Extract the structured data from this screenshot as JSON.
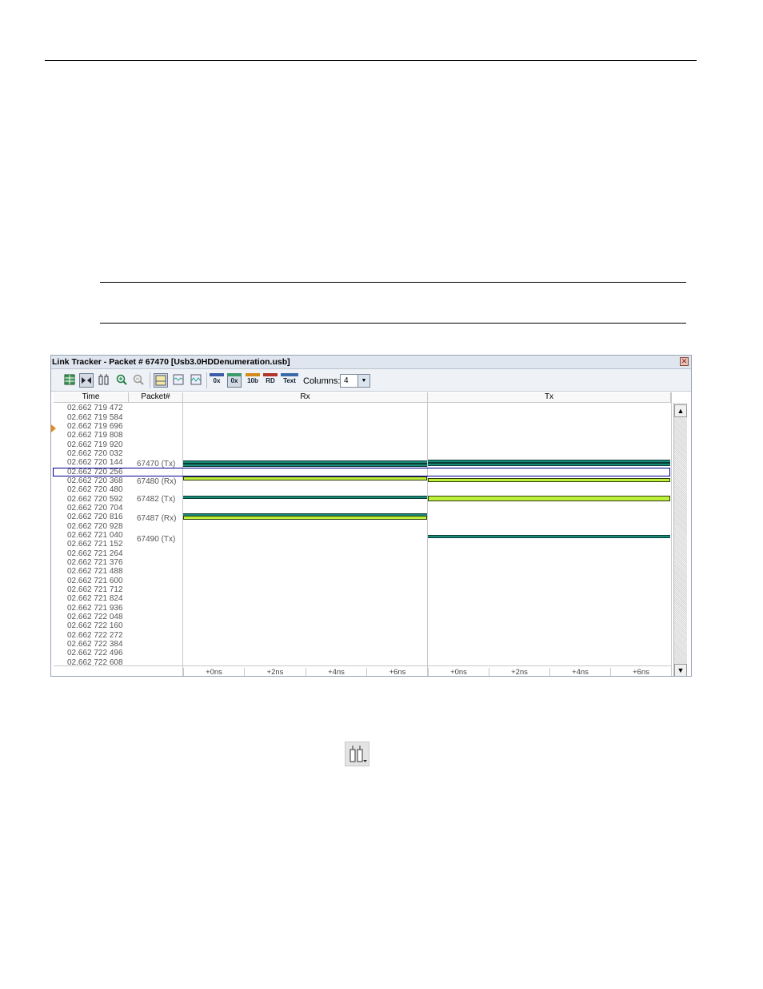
{
  "window": {
    "title": "Link Tracker - Packet # 67470 [Usb3.0HDDenumeration.usb]",
    "close_glyph": "✕"
  },
  "toolbar": {
    "buttons": [
      {
        "name": "grid-view-icon",
        "label": ""
      },
      {
        "name": "sync-icon",
        "label": ""
      },
      {
        "name": "columns-adjust-icon",
        "label": ""
      },
      {
        "name": "zoom-in-icon",
        "label": ""
      },
      {
        "name": "zoom-out-icon",
        "label": ""
      },
      {
        "name": "view-mode-1-icon",
        "label": ""
      },
      {
        "name": "view-mode-2-icon",
        "label": ""
      },
      {
        "name": "view-mode-3-icon",
        "label": ""
      },
      {
        "name": "hex-icon",
        "label": "0x"
      },
      {
        "name": "hex-scrambled-icon",
        "label": "0x"
      },
      {
        "name": "10b-icon",
        "label": "10b"
      },
      {
        "name": "rd-icon",
        "label": "RD"
      },
      {
        "name": "text-icon",
        "label": "Text"
      }
    ],
    "columns_label": "Columns:",
    "columns_value": "4",
    "dropdown_arrow": "▼"
  },
  "grid": {
    "headers": {
      "time": "Time",
      "packet": "Packet#",
      "rx": "Rx",
      "tx": "Tx"
    },
    "times": [
      "02.662 719 472",
      "02.662 719 584",
      "02.662 719 696",
      "02.662 719 808",
      "02.662 719 920",
      "02.662 720 032",
      "02.662 720 144",
      "02.662 720 256",
      "02.662 720 368",
      "02.662 720 480",
      "02.662 720 592",
      "02.662 720 704",
      "02.662 720 816",
      "02.662 720 928",
      "02.662 721 040",
      "02.662 721 152",
      "02.662 721 264",
      "02.662 721 376",
      "02.662 721 488",
      "02.662 721 600",
      "02.662 721 712",
      "02.662 721 824",
      "02.662 721 936",
      "02.662 722 048",
      "02.662 722 160",
      "02.662 722 272",
      "02.662 722 384",
      "02.662 722 496",
      "02.662 722 608"
    ],
    "packets": [
      "67470 (Tx)",
      "67480 (Rx)",
      "67482 (Tx)",
      "67487 (Rx)",
      "67490 (Tx)"
    ],
    "ticks_rx": [
      "+0ns",
      "+2ns",
      "+4ns",
      "+6ns"
    ],
    "ticks_tx": [
      "+0ns",
      "+2ns",
      "+4ns",
      "+6ns"
    ],
    "scroll_up": "▲",
    "scroll_down": "▼"
  },
  "colors": {
    "teal": "#1a8a79",
    "lime": "#bdf03a",
    "selection": "#000090",
    "marker": "#e08a22"
  }
}
